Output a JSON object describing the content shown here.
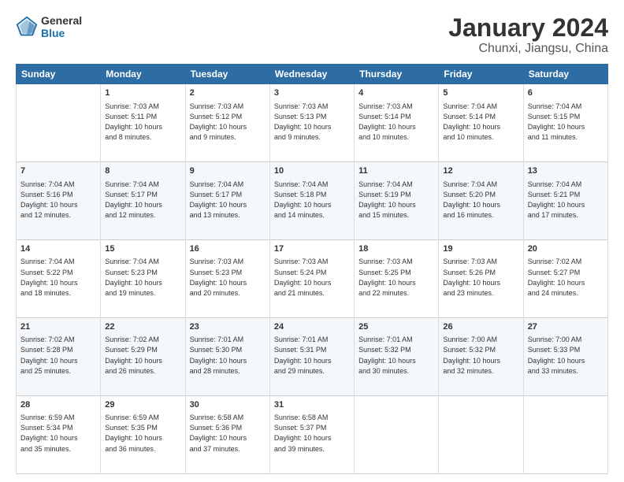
{
  "header": {
    "logo_line1": "General",
    "logo_line2": "Blue",
    "title": "January 2024",
    "subtitle": "Chunxi, Jiangsu, China"
  },
  "columns": [
    "Sunday",
    "Monday",
    "Tuesday",
    "Wednesday",
    "Thursday",
    "Friday",
    "Saturday"
  ],
  "weeks": [
    [
      {
        "day": "",
        "content": ""
      },
      {
        "day": "1",
        "content": "Sunrise: 7:03 AM\nSunset: 5:11 PM\nDaylight: 10 hours\nand 8 minutes."
      },
      {
        "day": "2",
        "content": "Sunrise: 7:03 AM\nSunset: 5:12 PM\nDaylight: 10 hours\nand 9 minutes."
      },
      {
        "day": "3",
        "content": "Sunrise: 7:03 AM\nSunset: 5:13 PM\nDaylight: 10 hours\nand 9 minutes."
      },
      {
        "day": "4",
        "content": "Sunrise: 7:03 AM\nSunset: 5:14 PM\nDaylight: 10 hours\nand 10 minutes."
      },
      {
        "day": "5",
        "content": "Sunrise: 7:04 AM\nSunset: 5:14 PM\nDaylight: 10 hours\nand 10 minutes."
      },
      {
        "day": "6",
        "content": "Sunrise: 7:04 AM\nSunset: 5:15 PM\nDaylight: 10 hours\nand 11 minutes."
      }
    ],
    [
      {
        "day": "7",
        "content": "Sunrise: 7:04 AM\nSunset: 5:16 PM\nDaylight: 10 hours\nand 12 minutes."
      },
      {
        "day": "8",
        "content": "Sunrise: 7:04 AM\nSunset: 5:17 PM\nDaylight: 10 hours\nand 12 minutes."
      },
      {
        "day": "9",
        "content": "Sunrise: 7:04 AM\nSunset: 5:17 PM\nDaylight: 10 hours\nand 13 minutes."
      },
      {
        "day": "10",
        "content": "Sunrise: 7:04 AM\nSunset: 5:18 PM\nDaylight: 10 hours\nand 14 minutes."
      },
      {
        "day": "11",
        "content": "Sunrise: 7:04 AM\nSunset: 5:19 PM\nDaylight: 10 hours\nand 15 minutes."
      },
      {
        "day": "12",
        "content": "Sunrise: 7:04 AM\nSunset: 5:20 PM\nDaylight: 10 hours\nand 16 minutes."
      },
      {
        "day": "13",
        "content": "Sunrise: 7:04 AM\nSunset: 5:21 PM\nDaylight: 10 hours\nand 17 minutes."
      }
    ],
    [
      {
        "day": "14",
        "content": "Sunrise: 7:04 AM\nSunset: 5:22 PM\nDaylight: 10 hours\nand 18 minutes."
      },
      {
        "day": "15",
        "content": "Sunrise: 7:04 AM\nSunset: 5:23 PM\nDaylight: 10 hours\nand 19 minutes."
      },
      {
        "day": "16",
        "content": "Sunrise: 7:03 AM\nSunset: 5:23 PM\nDaylight: 10 hours\nand 20 minutes."
      },
      {
        "day": "17",
        "content": "Sunrise: 7:03 AM\nSunset: 5:24 PM\nDaylight: 10 hours\nand 21 minutes."
      },
      {
        "day": "18",
        "content": "Sunrise: 7:03 AM\nSunset: 5:25 PM\nDaylight: 10 hours\nand 22 minutes."
      },
      {
        "day": "19",
        "content": "Sunrise: 7:03 AM\nSunset: 5:26 PM\nDaylight: 10 hours\nand 23 minutes."
      },
      {
        "day": "20",
        "content": "Sunrise: 7:02 AM\nSunset: 5:27 PM\nDaylight: 10 hours\nand 24 minutes."
      }
    ],
    [
      {
        "day": "21",
        "content": "Sunrise: 7:02 AM\nSunset: 5:28 PM\nDaylight: 10 hours\nand 25 minutes."
      },
      {
        "day": "22",
        "content": "Sunrise: 7:02 AM\nSunset: 5:29 PM\nDaylight: 10 hours\nand 26 minutes."
      },
      {
        "day": "23",
        "content": "Sunrise: 7:01 AM\nSunset: 5:30 PM\nDaylight: 10 hours\nand 28 minutes."
      },
      {
        "day": "24",
        "content": "Sunrise: 7:01 AM\nSunset: 5:31 PM\nDaylight: 10 hours\nand 29 minutes."
      },
      {
        "day": "25",
        "content": "Sunrise: 7:01 AM\nSunset: 5:32 PM\nDaylight: 10 hours\nand 30 minutes."
      },
      {
        "day": "26",
        "content": "Sunrise: 7:00 AM\nSunset: 5:32 PM\nDaylight: 10 hours\nand 32 minutes."
      },
      {
        "day": "27",
        "content": "Sunrise: 7:00 AM\nSunset: 5:33 PM\nDaylight: 10 hours\nand 33 minutes."
      }
    ],
    [
      {
        "day": "28",
        "content": "Sunrise: 6:59 AM\nSunset: 5:34 PM\nDaylight: 10 hours\nand 35 minutes."
      },
      {
        "day": "29",
        "content": "Sunrise: 6:59 AM\nSunset: 5:35 PM\nDaylight: 10 hours\nand 36 minutes."
      },
      {
        "day": "30",
        "content": "Sunrise: 6:58 AM\nSunset: 5:36 PM\nDaylight: 10 hours\nand 37 minutes."
      },
      {
        "day": "31",
        "content": "Sunrise: 6:58 AM\nSunset: 5:37 PM\nDaylight: 10 hours\nand 39 minutes."
      },
      {
        "day": "",
        "content": ""
      },
      {
        "day": "",
        "content": ""
      },
      {
        "day": "",
        "content": ""
      }
    ]
  ]
}
